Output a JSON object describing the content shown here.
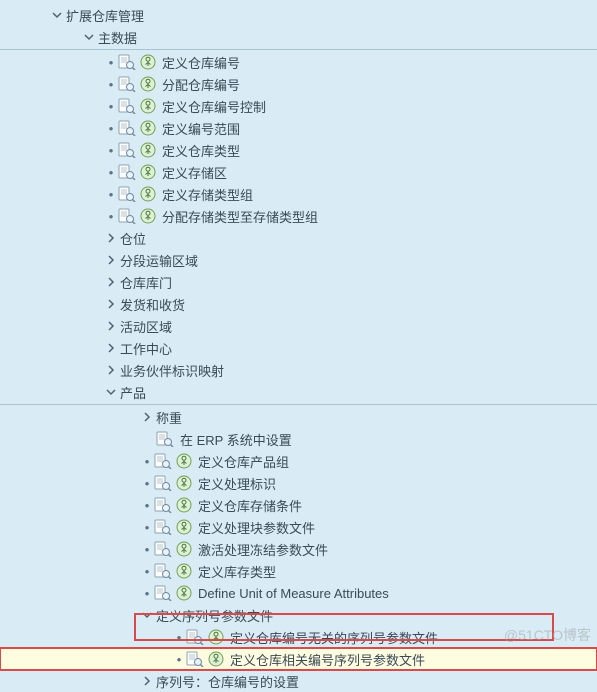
{
  "watermark": "@51CTO博客",
  "tree": [
    {
      "indent": 50,
      "toggle": "down",
      "label": "扩展仓库管理"
    },
    {
      "indent": 82,
      "toggle": "down",
      "label": "主数据"
    },
    {
      "indent": 104,
      "bullet": true,
      "doc": true,
      "exec": true,
      "label": "定义仓库编号"
    },
    {
      "indent": 104,
      "bullet": true,
      "doc": true,
      "exec": true,
      "label": "分配仓库编号"
    },
    {
      "indent": 104,
      "bullet": true,
      "doc": true,
      "exec": true,
      "label": "定义仓库编号控制"
    },
    {
      "indent": 104,
      "bullet": true,
      "doc": true,
      "exec": true,
      "label": "定义编号范围"
    },
    {
      "indent": 104,
      "bullet": true,
      "doc": true,
      "exec": true,
      "label": "定义仓库类型"
    },
    {
      "indent": 104,
      "bullet": true,
      "doc": true,
      "exec": true,
      "label": "定义存储区"
    },
    {
      "indent": 104,
      "bullet": true,
      "doc": true,
      "exec": true,
      "label": "定义存储类型组"
    },
    {
      "indent": 104,
      "bullet": true,
      "doc": true,
      "exec": true,
      "label": "分配存储类型至存储类型组"
    },
    {
      "indent": 104,
      "toggle": "right",
      "label": "仓位"
    },
    {
      "indent": 104,
      "toggle": "right",
      "label": "分段运输区域"
    },
    {
      "indent": 104,
      "toggle": "right",
      "label": "仓库库门"
    },
    {
      "indent": 104,
      "toggle": "right",
      "label": "发货和收货"
    },
    {
      "indent": 104,
      "toggle": "right",
      "label": "活动区域"
    },
    {
      "indent": 104,
      "toggle": "right",
      "label": "工作中心"
    },
    {
      "indent": 104,
      "toggle": "right",
      "label": "业务伙伴标识映射"
    },
    {
      "indent": 104,
      "toggle": "down",
      "label": "产品"
    },
    {
      "indent": 140,
      "toggle": "right",
      "label": "称重"
    },
    {
      "indent": 140,
      "doc": true,
      "label": "在 ERP 系统中设置"
    },
    {
      "indent": 140,
      "bullet": true,
      "doc": true,
      "exec": true,
      "label": "定义仓库产品组"
    },
    {
      "indent": 140,
      "bullet": true,
      "doc": true,
      "exec": true,
      "label": "定义处理标识"
    },
    {
      "indent": 140,
      "bullet": true,
      "doc": true,
      "exec": true,
      "label": "定义仓库存储条件"
    },
    {
      "indent": 140,
      "bullet": true,
      "doc": true,
      "exec": true,
      "label": "定义处理块参数文件"
    },
    {
      "indent": 140,
      "bullet": true,
      "doc": true,
      "exec": true,
      "label": "激活处理冻结参数文件"
    },
    {
      "indent": 140,
      "bullet": true,
      "doc": true,
      "exec": true,
      "label": "定义库存类型"
    },
    {
      "indent": 140,
      "bullet": true,
      "doc": true,
      "exec": true,
      "label": "Define Unit of Measure Attributes"
    },
    {
      "indent": 140,
      "toggle": "down",
      "label": "定义序列号参数文件"
    },
    {
      "indent": 172,
      "bullet": true,
      "doc": true,
      "exec": true,
      "label": "定义仓库编号无关的序列号参数文件"
    },
    {
      "indent": 172,
      "bullet": true,
      "doc": true,
      "exec": true,
      "label": "定义仓库相关编号序列号参数文件",
      "highlight": true
    },
    {
      "indent": 140,
      "toggle": "right",
      "label": "序列号：仓库编号的设置"
    }
  ]
}
